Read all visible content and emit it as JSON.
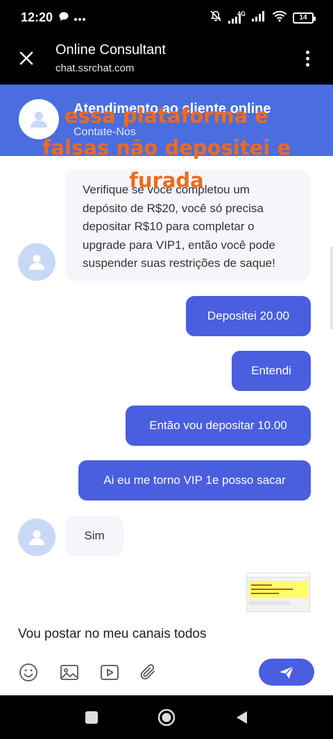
{
  "status_bar": {
    "time": "12:20",
    "network_label": "4G",
    "battery": "14"
  },
  "app_bar": {
    "title": "Online Consultant",
    "url": "chat.ssrchat.com"
  },
  "chat_header": {
    "title": "Atendimento ao cliente online",
    "subtitle": "Contate-Nos"
  },
  "overlay_caption": {
    "line1": "essa plataforma e",
    "line2": "falsas não depositei e",
    "line3": "furada"
  },
  "messages": [
    {
      "from": "agent",
      "text": "Verifique se você completou um depósito de R$20, você só precisa depositar R$10 para completar o upgrade para VIP1, então você pode suspender suas restrições de saque!"
    },
    {
      "from": "user",
      "text": "Depositei 20.00"
    },
    {
      "from": "user",
      "text": "Entendi"
    },
    {
      "from": "user",
      "text": "Então vou depositar 10.00"
    },
    {
      "from": "user",
      "text": "Ai eu me torno VIP 1e posso sacar"
    },
    {
      "from": "agent",
      "text": "Sim"
    }
  ],
  "composer": {
    "draft": "Vou postar no meu canais todos"
  },
  "colors": {
    "header_blue": "#4a6ee0",
    "outgoing_bubble": "#4a5ee0",
    "overlay_orange": "#f26a1b"
  }
}
